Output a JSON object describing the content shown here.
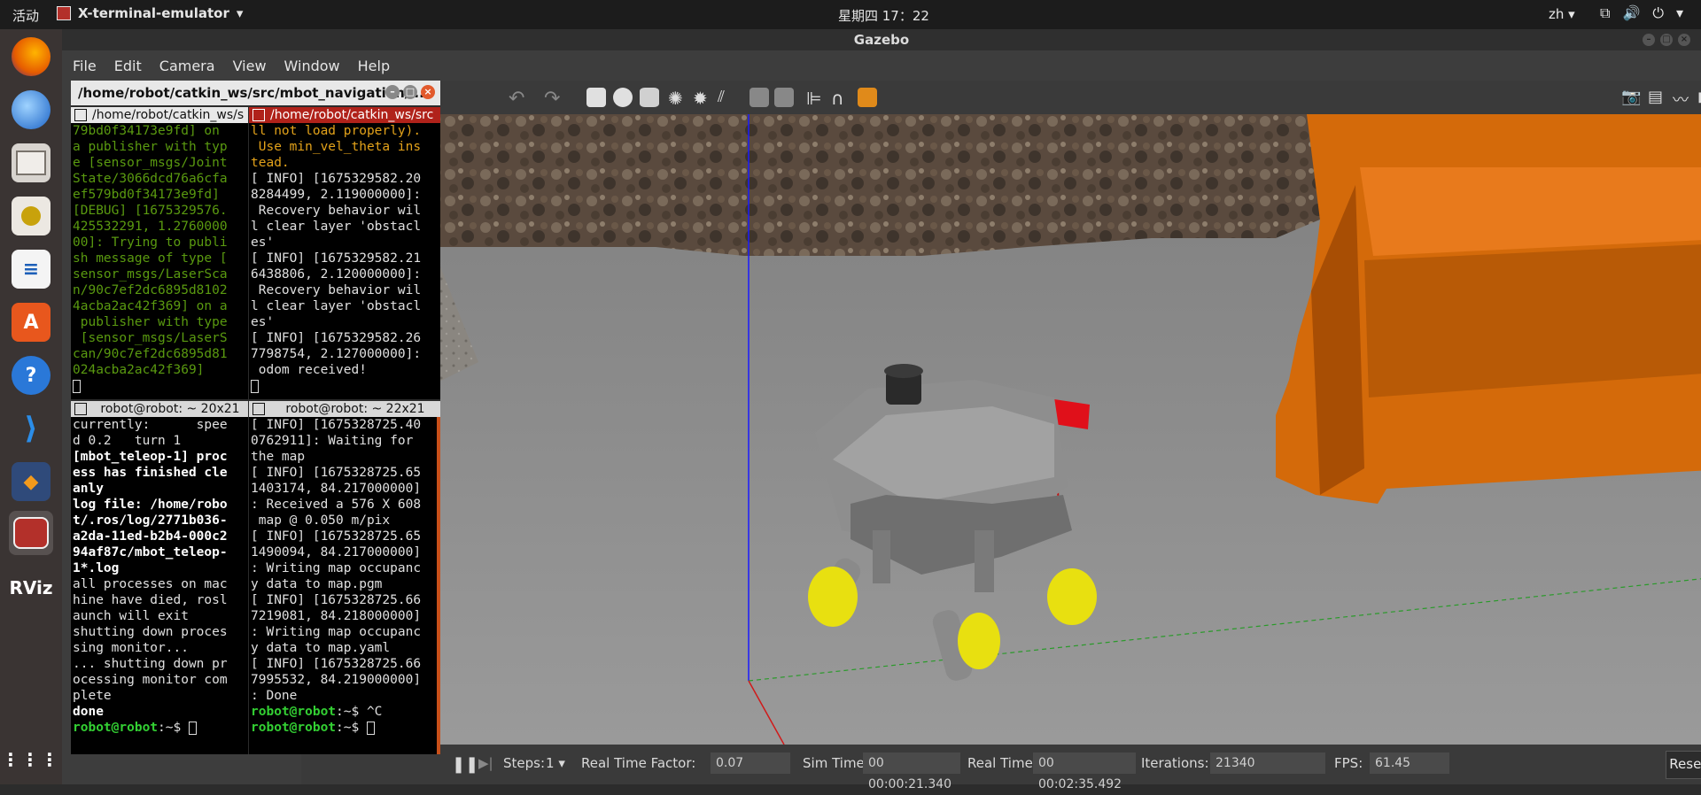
{
  "top_bar": {
    "activities": "活动",
    "app_menu": "X-terminal-emulator",
    "clock": "星期四 17：22",
    "lang": "zh"
  },
  "gazebo": {
    "title": "Gazebo",
    "menu": [
      "File",
      "Edit",
      "Camera",
      "View",
      "Window",
      "Help"
    ],
    "status": {
      "steps_label": "Steps:",
      "steps_value": "1",
      "rtf_label": "Real Time Factor:",
      "rtf_value": "0.07",
      "sim_time_label": "Sim Time:",
      "sim_time_value": "00 00:00:21.340",
      "real_time_label": "Real Time:",
      "real_time_value": "00 00:02:35.492",
      "iterations_label": "Iterations:",
      "iterations_value": "21340",
      "fps_label": "FPS:",
      "fps_value": "61.45",
      "reset_label": "Reset Time"
    }
  },
  "terminal": {
    "title": "/home/robot/catkin_ws/src/mbot_navigation/l...",
    "panes": [
      {
        "title": "/home/robot/catkin_ws/s",
        "lines": [
          "79bd0f34173e9fd] on",
          "a publisher with typ",
          "e [sensor_msgs/Joint",
          "State/3066dcd76a6cfa",
          "ef579bd0f34173e9fd]",
          "[DEBUG] [1675329576.",
          "425532291, 1.2760000",
          "00]: Trying to publi",
          "sh message of type [",
          "sensor_msgs/LaserSca",
          "n/90c7ef2dc6895d8102",
          "4acba2ac42f369] on a",
          " publisher with type",
          " [sensor_msgs/LaserS",
          "can/90c7ef2dc6895d81",
          "024acba2ac42f369]"
        ]
      },
      {
        "title": "/home/robot/catkin_ws/src",
        "lines": [
          "ll not load properly).",
          " Use min_vel_theta ins",
          "tead.",
          "[ INFO] [1675329582.20",
          "8284499, 2.119000000]:",
          " Recovery behavior wil",
          "l clear layer 'obstacl",
          "es'",
          "[ INFO] [1675329582.21",
          "6438806, 2.120000000]:",
          " Recovery behavior wil",
          "l clear layer 'obstacl",
          "es'",
          "[ INFO] [1675329582.26",
          "7798754, 2.127000000]:",
          " odom received!"
        ]
      },
      {
        "title": "robot@robot: ~ 20x21",
        "lines": [
          "",
          "currently:      spee",
          "d 0.2   turn 1",
          "[mbot_teleop-1] proc",
          "ess has finished cle",
          "anly",
          "log file: /home/robo",
          "t/.ros/log/2771b036-",
          "a2da-11ed-b2b4-000c2",
          "94af87c/mbot_teleop-",
          "1*.log",
          "all processes on mac",
          "hine have died, rosl",
          "aunch will exit",
          "shutting down proces",
          "sing monitor...",
          "... shutting down pr",
          "ocessing monitor com",
          "plete",
          "done"
        ],
        "prompt": "robot@robot",
        "prompt_suffix": ":~$ "
      },
      {
        "title": "robot@robot: ~ 22x21",
        "lines": [
          "[ INFO] [1675328725.40",
          "0762911]: Waiting for",
          "the map",
          "[ INFO] [1675328725.65",
          "1403174, 84.217000000]",
          ": Received a 576 X 608",
          " map @ 0.050 m/pix",
          "[ INFO] [1675328725.65",
          "1490094, 84.217000000]",
          ": Writing map occupanc",
          "y data to map.pgm",
          "[ INFO] [1675328725.66",
          "7219081, 84.218000000]",
          ": Writing map occupanc",
          "y data to map.yaml",
          "[ INFO] [1675328725.66",
          "7995532, 84.219000000]",
          ": Done",
          ""
        ],
        "prompt": "robot@robot",
        "prompt_line1_suffix": ":~$ ^C",
        "prompt_line2_suffix": ":~$ "
      }
    ]
  },
  "dock": [
    "firefox-icon",
    "thunderbird-icon",
    "files-icon",
    "rhythmbox-icon",
    "libreoffice-writer-icon",
    "software-center-icon",
    "help-icon",
    "vscode-icon",
    "virtualbox-icon",
    "terminal-icon",
    "rviz-icon",
    "app-grid-icon"
  ],
  "dock_labels": {
    "rviz": "RViz"
  },
  "colors": {
    "terminal_green": "#5a9a10",
    "terminal_orange": "#e3a21a",
    "prompt_green": "#33d033",
    "obstacle_orange": "#d46a0a",
    "flag_red": "#e0101a",
    "wheel_yellow": "#e8e010"
  }
}
